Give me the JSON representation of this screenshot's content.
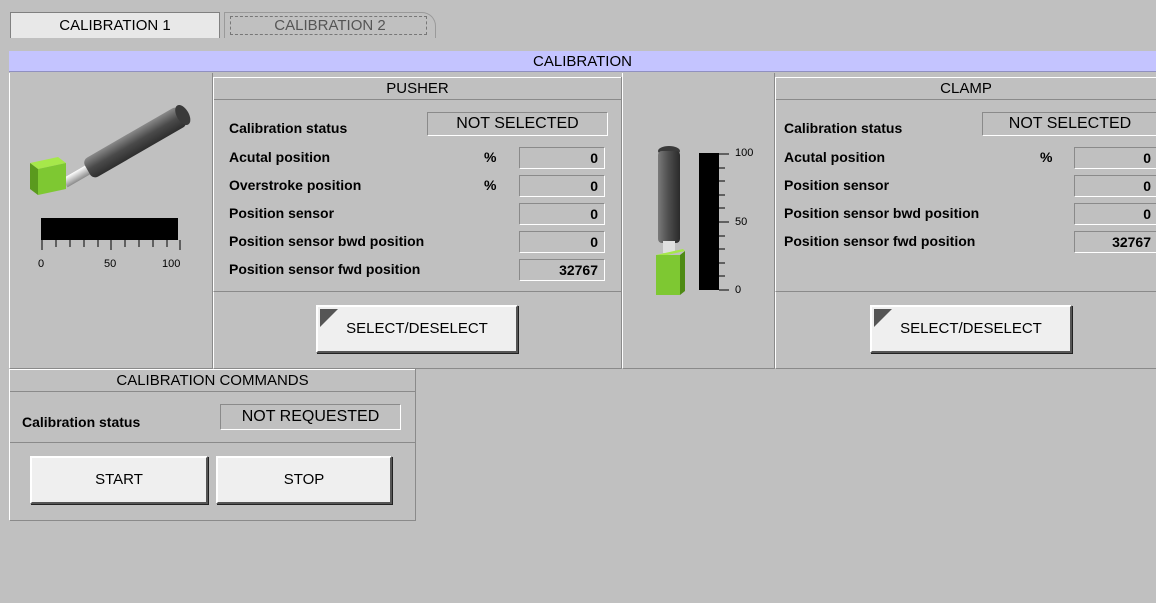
{
  "tabs": [
    {
      "label": "CALIBRATION 1",
      "active": true
    },
    {
      "label": "CALIBRATION 2",
      "active": false
    }
  ],
  "banner": {
    "title": "CALIBRATION"
  },
  "pusher": {
    "title": "PUSHER",
    "status_label": "Calibration status",
    "status_value": "NOT SELECTED",
    "rows": [
      {
        "label": "Acutal position",
        "unit": "%",
        "value": "0"
      },
      {
        "label": "Overstroke position",
        "unit": "%",
        "value": "0"
      },
      {
        "label": "Position sensor",
        "unit": "",
        "value": "0"
      },
      {
        "label": "Position sensor bwd position",
        "unit": "",
        "value": "0"
      },
      {
        "label": "Position sensor fwd position",
        "unit": "",
        "value": "32767"
      }
    ],
    "button_label": "SELECT/DESELECT",
    "scale_ticks": [
      "0",
      "50",
      "100"
    ]
  },
  "clamp": {
    "title": "CLAMP",
    "status_label": "Calibration status",
    "status_value": "NOT SELECTED",
    "rows": [
      {
        "label": "Acutal position",
        "unit": "%",
        "value": "0"
      },
      {
        "label": "Position sensor",
        "unit": "",
        "value": "0"
      },
      {
        "label": "Position sensor bwd position",
        "unit": "",
        "value": "0"
      },
      {
        "label": "Position sensor fwd position",
        "unit": "",
        "value": "32767"
      }
    ],
    "button_label": "SELECT/DESELECT",
    "scale_ticks": [
      "100",
      "50",
      "0"
    ]
  },
  "commands": {
    "title": "CALIBRATION COMMANDS",
    "status_label": "Calibration status",
    "status_value": "NOT REQUESTED",
    "start_label": "START",
    "stop_label": "STOP"
  },
  "colors": {
    "banner": "#c4c4ff",
    "actuator_green": "#7ec832",
    "background": "#c0c0c0"
  }
}
